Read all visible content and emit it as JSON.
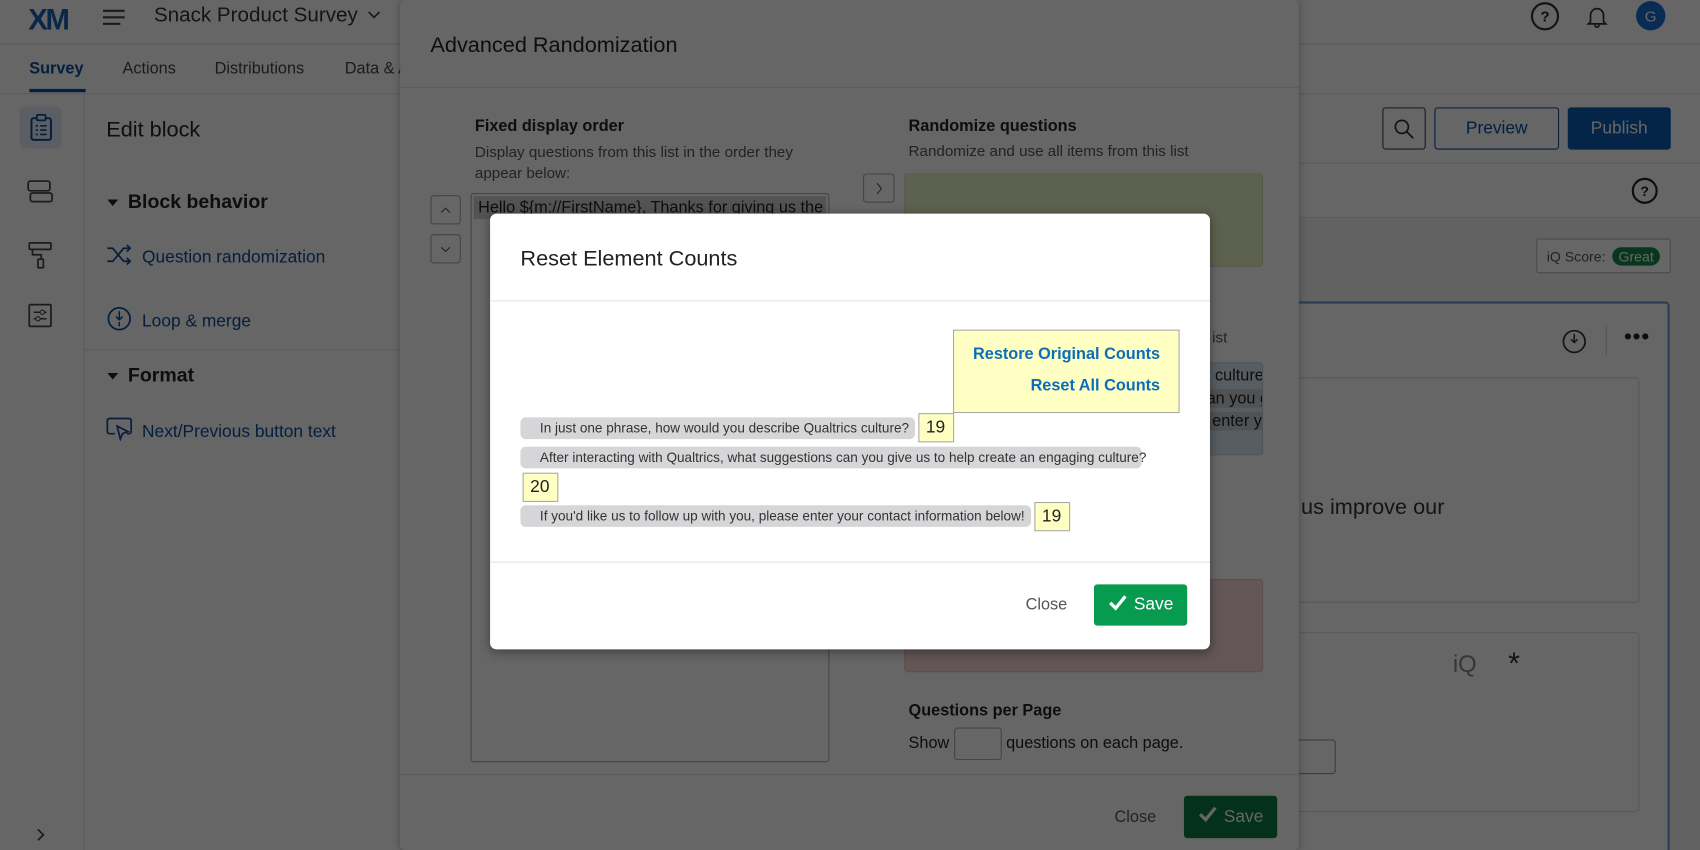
{
  "header": {
    "logo": "XM",
    "survey_title": "Snack Product Survey",
    "avatar_initial": "G"
  },
  "tabs": [
    {
      "label": "Survey",
      "active": true
    },
    {
      "label": "Actions"
    },
    {
      "label": "Distributions"
    },
    {
      "label": "Data & Analysis"
    }
  ],
  "edit_panel": {
    "title": "Edit block",
    "section_behavior": "Block behavior",
    "question_randomization": "Question randomization",
    "loop_merge": "Loop & merge",
    "section_format": "Format",
    "next_prev_text": "Next/Previous button text"
  },
  "toolbar": {
    "preview": "Preview",
    "publish": "Publish",
    "iq_score_label": "iQ Score:",
    "iq_score_value": "Great",
    "iq_label": "iQ"
  },
  "question_card": {
    "text_fragment": "us improve our"
  },
  "advanced_randomization": {
    "title": "Advanced Randomization",
    "fixed_title": "Fixed display order",
    "fixed_desc": "Display questions from this list in the order they appear below:",
    "fixed_items": [
      "Hello ${m://FirstName}, Thanks for giving us the"
    ],
    "random_title": "Randomize questions",
    "random_desc": "Randomize and use all items from this list",
    "subset_label_fragment": "ist",
    "qpp_title": "Questions per Page",
    "qpp_show": "Show",
    "qpp_value": "",
    "qpp_suffix": "questions on each page.",
    "close": "Close",
    "save": "Save"
  },
  "reset_dialog": {
    "title": "Reset Element Counts",
    "restore_link": "Restore Original Counts",
    "reset_link": "Reset All Counts",
    "rows": [
      {
        "question": "In just one phrase, how would you describe Qualtrics culture?",
        "count": "19"
      },
      {
        "question": "After interacting with Qualtrics, what suggestions can you give us to help create an engaging culture?",
        "count": "20"
      },
      {
        "question": "If you'd like us to follow up with you, please enter your contact information below!",
        "count": "19"
      }
    ],
    "close": "Close",
    "save": "Save"
  },
  "colors": {
    "brand_blue": "#0b4a9c",
    "publish_bg": "#0b5cb5",
    "save_green": "#079b50",
    "link_blue": "#0a6ebd",
    "yellow": "#ffffc4"
  }
}
